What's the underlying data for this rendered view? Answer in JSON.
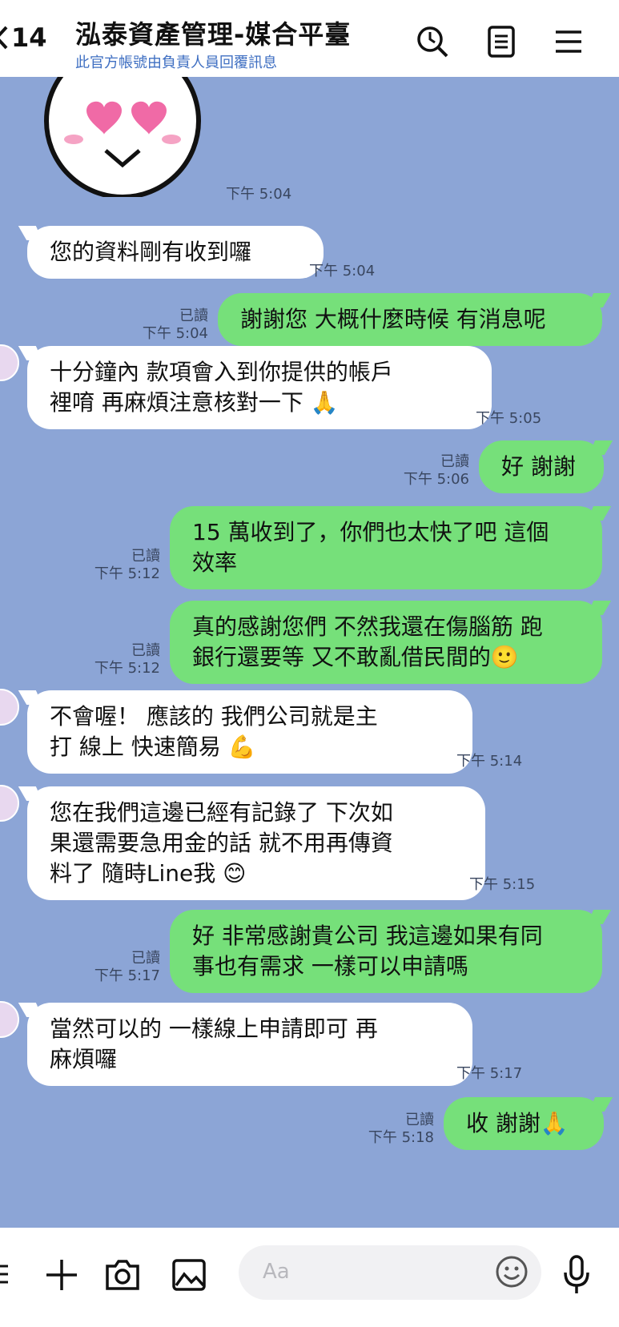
{
  "header": {
    "back_count": "14",
    "title": "泓泰資產管理-媒合平臺",
    "subtitle": "此官方帳號由負責人員回覆訊息",
    "icons": [
      "search-icon",
      "notes-icon",
      "menu-icon"
    ]
  },
  "colors": {
    "chat_bg": "#8ca5d6",
    "outgoing": "#76e07a",
    "incoming": "#ffffff",
    "subtitle": "#3f6fc2"
  },
  "messages": [
    {
      "id": 0,
      "type": "sticker",
      "direction": "in",
      "time": "下午 5:04"
    },
    {
      "id": 1,
      "direction": "in",
      "lines": [
        "您的資料剛有收到囉"
      ],
      "time": "下午 5:04"
    },
    {
      "id": 2,
      "direction": "out",
      "lines": [
        "謝謝您 大概什麼時候 有消息呢"
      ],
      "read": "已讀",
      "time": "下午 5:04"
    },
    {
      "id": 3,
      "direction": "in",
      "lines": [
        " 十分鐘內 款項會入到你提供的帳戶",
        "裡唷 再麻煩注意核對一下 🙏"
      ],
      "time": "下午 5:05"
    },
    {
      "id": 4,
      "direction": "out",
      "lines": [
        "好 謝謝"
      ],
      "read": "已讀",
      "time": "下午 5:06"
    },
    {
      "id": 5,
      "direction": "out",
      "lines": [
        "15 萬收到了，你們也太快了吧 這個",
        "效率"
      ],
      "read": "已讀",
      "time": "下午 5:12"
    },
    {
      "id": 6,
      "direction": "out",
      "lines": [
        "真的感謝您們 不然我還在傷腦筋 跑",
        "銀行還要等 又不敢亂借民間的🙂"
      ],
      "read": "已讀",
      "time": "下午 5:12"
    },
    {
      "id": 7,
      "direction": "in",
      "lines": [
        "不會喔！ 應該的 我們公司就是主",
        "打 線上 快速簡易  💪"
      ],
      "time": "下午 5:14"
    },
    {
      "id": 8,
      "direction": "in",
      "lines": [
        "您在我們這邊已經有記錄了 下次如",
        "果還需要急用金的話 就不用再傳資",
        "料了 隨時Line我 😊"
      ],
      "time": "下午 5:15"
    },
    {
      "id": 9,
      "direction": "out",
      "lines": [
        "好 非常感謝貴公司 我這邊如果有同",
        "事也有需求 一樣可以申請嗎"
      ],
      "read": "已讀",
      "time": "下午 5:17"
    },
    {
      "id": 10,
      "direction": "in",
      "lines": [
        "當然可以的 一樣線上申請即可  再",
        "麻煩囉"
      ],
      "time": "下午 5:17"
    },
    {
      "id": 11,
      "direction": "out",
      "lines": [
        "收 謝謝🙏"
      ],
      "read": "已讀",
      "time": "下午 5:18"
    }
  ],
  "footer": {
    "input_placeholder": "Aa",
    "icons": [
      "menu-icon",
      "plus-icon",
      "camera-icon",
      "image-icon",
      "emoji-icon",
      "microphone-icon"
    ]
  }
}
